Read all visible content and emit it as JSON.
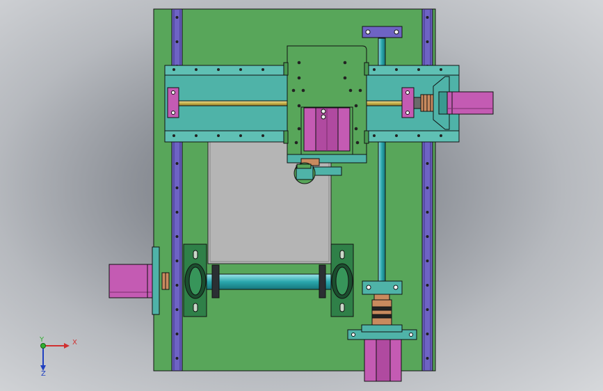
{
  "colors": {
    "frame": "#58a65a",
    "rail": "#6e63c4",
    "gantry": "#4fb3a8",
    "motor": "#c45bb3",
    "plate": "#b5b5b5",
    "shaft": "#3ab3b8",
    "bearing": "#2f8048",
    "screw": "#c8b24a",
    "copper": "#c98a5e",
    "outline": "#111111"
  },
  "triad": {
    "x_label": "X",
    "y_label": "Y",
    "z_label": "Z",
    "x_color": "#d03030",
    "y_color": "#30b030",
    "z_color": "#2040c0"
  }
}
